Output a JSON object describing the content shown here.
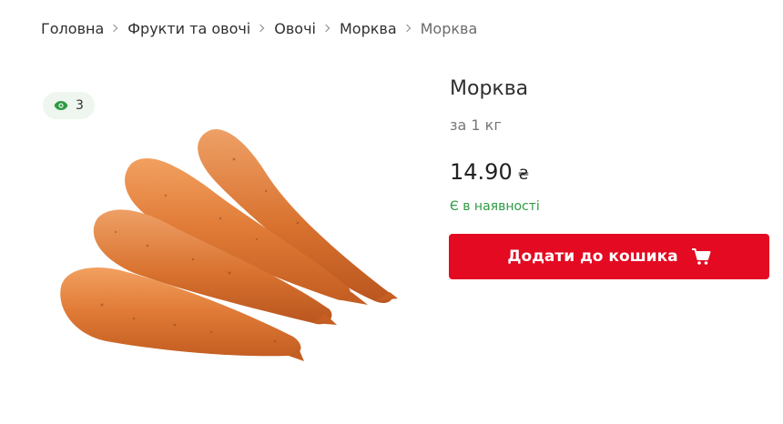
{
  "breadcrumb": {
    "items": [
      "Головна",
      "Фрукти та овочі",
      "Овочі",
      "Морква"
    ],
    "current": "Морква"
  },
  "views": {
    "icon": "eye-icon",
    "count": "3",
    "color": "#2e9a43"
  },
  "product": {
    "title": "Морква",
    "unit": "за 1 кг",
    "price": "14.90",
    "currency": "₴",
    "availability": "Є в наявності",
    "availability_color": "#2e9a43"
  },
  "cart_button": {
    "label": "Додати до кошика",
    "icon": "cart-icon",
    "color": "#e30a22"
  }
}
